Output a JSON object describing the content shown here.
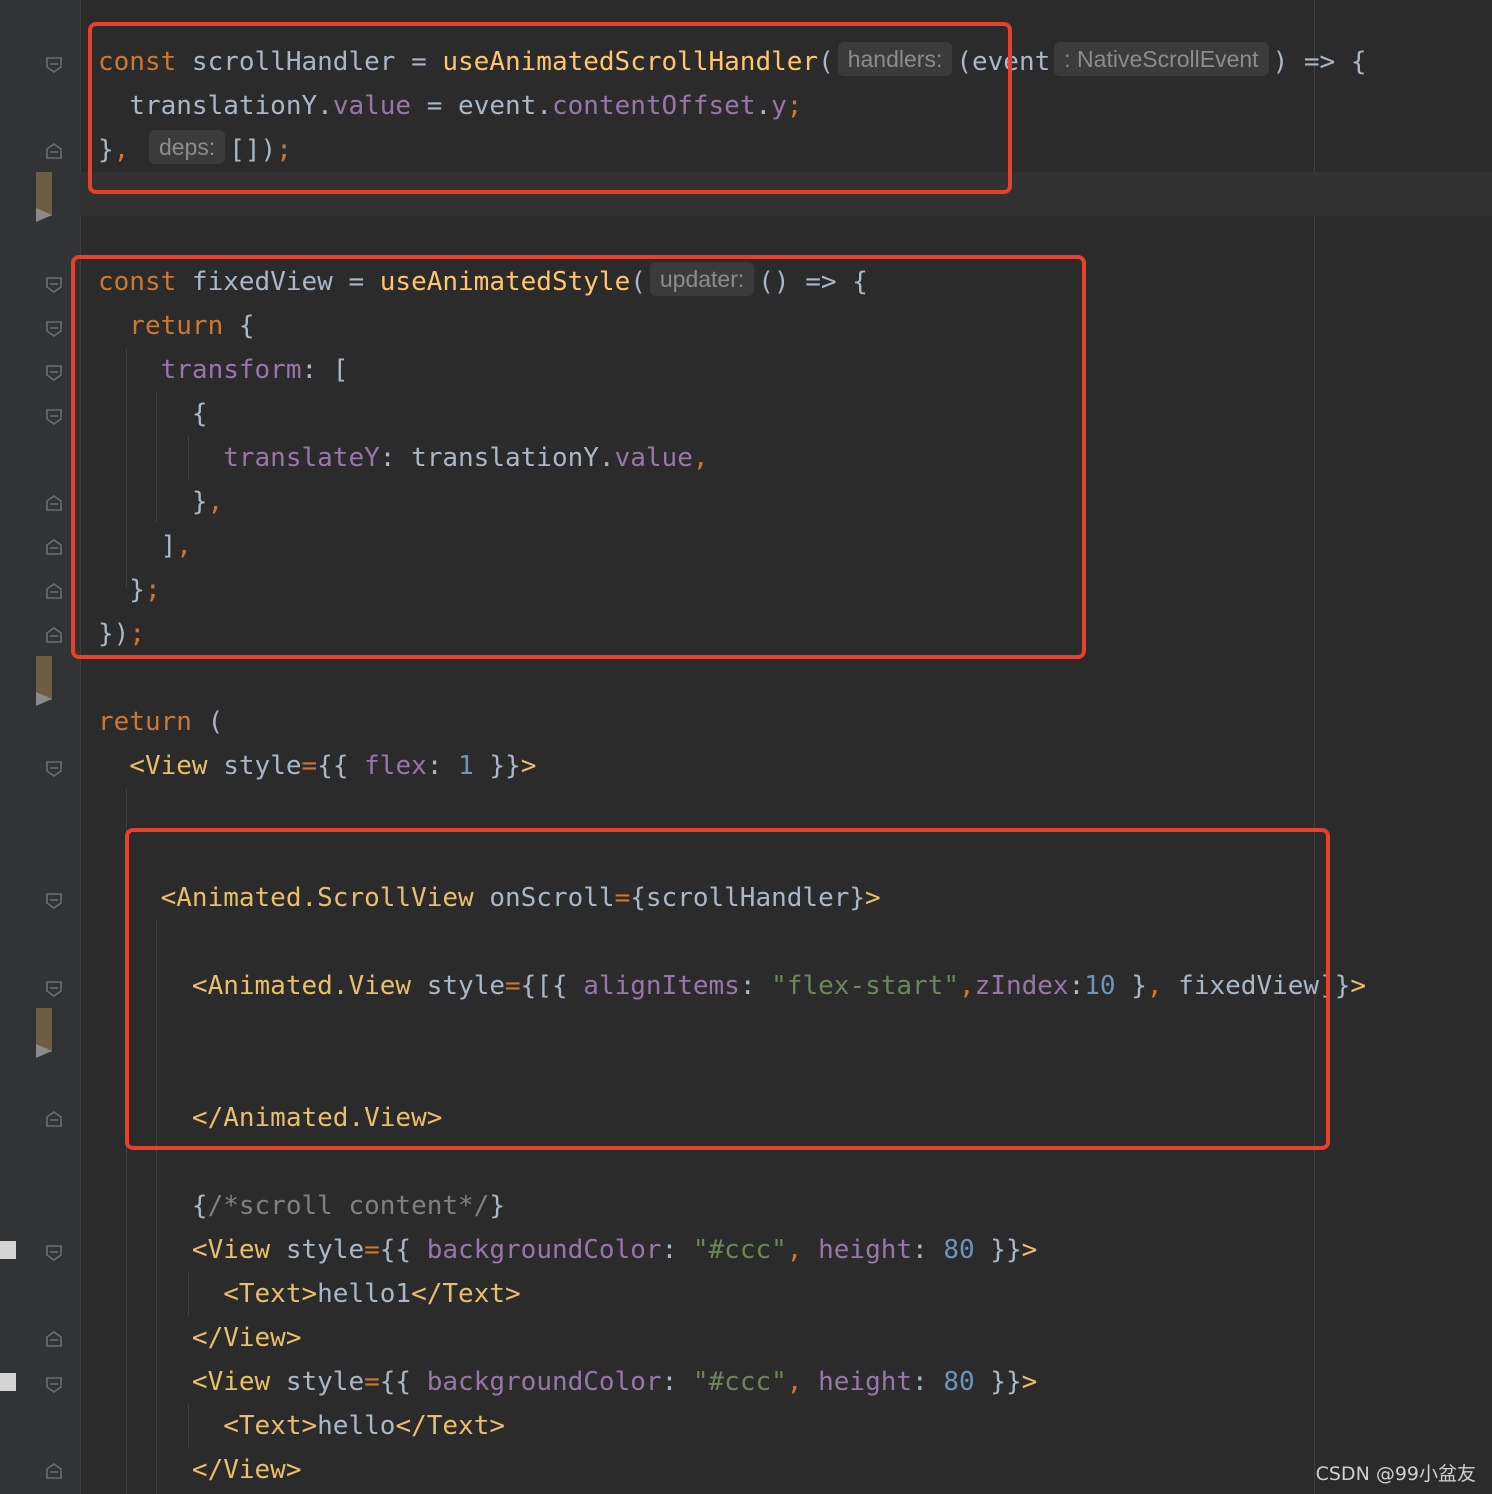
{
  "editor": {
    "lines": [
      {
        "id": "l1",
        "parts": [
          [
            "kw",
            "const "
          ],
          [
            "pl",
            "scrollHandler = "
          ],
          [
            "fn",
            "useAnimatedScrollHandler"
          ],
          [
            "pl",
            "("
          ],
          [
            "hint",
            "handlers:"
          ],
          [
            "pl",
            "(event"
          ],
          [
            "hint",
            ": NativeScrollEvent"
          ],
          [
            "pl",
            ") => {"
          ]
        ]
      },
      {
        "id": "l2",
        "parts": [
          [
            "pl",
            "  translationY."
          ],
          [
            "prop",
            "value"
          ],
          [
            "pl",
            " = event."
          ],
          [
            "prop",
            "contentOffset"
          ],
          [
            "pl",
            "."
          ],
          [
            "prop",
            "y"
          ],
          [
            "kw",
            ";"
          ]
        ]
      },
      {
        "id": "l3",
        "parts": [
          [
            "pl",
            "}"
          ],
          [
            "kw",
            ", "
          ],
          [
            "hint",
            "deps:"
          ],
          [
            "pl",
            "[])"
          ],
          [
            "kw",
            ";"
          ]
        ]
      },
      {
        "id": "l5",
        "parts": [
          [
            "kw",
            "const "
          ],
          [
            "pl",
            "fixedView = "
          ],
          [
            "fn",
            "useAnimatedStyle"
          ],
          [
            "pl",
            "("
          ],
          [
            "hint",
            "updater:"
          ],
          [
            "pl",
            "() => {"
          ]
        ]
      },
      {
        "id": "l6",
        "parts": [
          [
            "kw",
            "  return "
          ],
          [
            "pl",
            "{"
          ]
        ]
      },
      {
        "id": "l7",
        "parts": [
          [
            "prop",
            "    transform"
          ],
          [
            "pl",
            ": ["
          ]
        ]
      },
      {
        "id": "l8",
        "parts": [
          [
            "pl",
            "      {"
          ]
        ]
      },
      {
        "id": "l9",
        "parts": [
          [
            "prop",
            "        translateY"
          ],
          [
            "pl",
            ": translationY."
          ],
          [
            "prop",
            "value"
          ],
          [
            "kw",
            ","
          ]
        ]
      },
      {
        "id": "l10",
        "parts": [
          [
            "pl",
            "      }"
          ],
          [
            "kw",
            ","
          ]
        ]
      },
      {
        "id": "l11",
        "parts": [
          [
            "pl",
            "    ]"
          ],
          [
            "kw",
            ","
          ]
        ]
      },
      {
        "id": "l12",
        "parts": [
          [
            "pl",
            "  }"
          ],
          [
            "kw",
            ";"
          ]
        ]
      },
      {
        "id": "l13",
        "parts": [
          [
            "pl",
            "})"
          ],
          [
            "kw",
            ";"
          ]
        ]
      },
      {
        "id": "l15",
        "parts": [
          [
            "kw",
            "return "
          ],
          [
            "pl",
            "("
          ]
        ]
      },
      {
        "id": "l16",
        "parts": [
          [
            "tag",
            "  <View "
          ],
          [
            "pl",
            "style"
          ],
          [
            "kw",
            "="
          ],
          [
            "pl",
            "{{ "
          ],
          [
            "prop",
            "flex"
          ],
          [
            "pl",
            ": "
          ],
          [
            "num",
            "1"
          ],
          [
            "pl",
            " }}"
          ],
          [
            "tag",
            ">"
          ]
        ]
      },
      {
        "id": "l19",
        "parts": [
          [
            "tag",
            "    <Animated.ScrollView "
          ],
          [
            "pl",
            "onScroll"
          ],
          [
            "kw",
            "="
          ],
          [
            "pl",
            "{scrollHandler}"
          ],
          [
            "tag",
            ">"
          ]
        ]
      },
      {
        "id": "l21",
        "parts": [
          [
            "tag",
            "      <Animated.View "
          ],
          [
            "pl",
            "style"
          ],
          [
            "kw",
            "="
          ],
          [
            "pl",
            "{[{ "
          ],
          [
            "prop",
            "alignItems"
          ],
          [
            "pl",
            ": "
          ],
          [
            "str",
            "\"flex-start\""
          ],
          [
            "kw",
            ","
          ],
          [
            "prop",
            "zIndex"
          ],
          [
            "pl",
            ":"
          ],
          [
            "num",
            "10"
          ],
          [
            "pl",
            " }"
          ],
          [
            "kw",
            ", "
          ],
          [
            "pl",
            "fixedView]}"
          ],
          [
            "tag",
            ">"
          ]
        ]
      },
      {
        "id": "l24",
        "parts": [
          [
            "tag",
            "      </Animated.View>"
          ]
        ]
      },
      {
        "id": "l26",
        "parts": [
          [
            "pl",
            "      {"
          ],
          [
            "cmt",
            "/*scroll content*/"
          ],
          [
            "pl",
            "}"
          ]
        ]
      },
      {
        "id": "l27",
        "parts": [
          [
            "tag",
            "      <View "
          ],
          [
            "pl",
            "style"
          ],
          [
            "kw",
            "="
          ],
          [
            "pl",
            "{{ "
          ],
          [
            "prop",
            "backgroundColor"
          ],
          [
            "pl",
            ": "
          ],
          [
            "str",
            "\"#ccc\""
          ],
          [
            "kw",
            ", "
          ],
          [
            "prop",
            "height"
          ],
          [
            "pl",
            ": "
          ],
          [
            "num",
            "80"
          ],
          [
            "pl",
            " }}"
          ],
          [
            "tag",
            ">"
          ]
        ]
      },
      {
        "id": "l28",
        "parts": [
          [
            "tag",
            "        <Text>"
          ],
          [
            "pl",
            "hello1"
          ],
          [
            "tag",
            "</Text>"
          ]
        ]
      },
      {
        "id": "l29",
        "parts": [
          [
            "tag",
            "      </View>"
          ]
        ]
      },
      {
        "id": "l30",
        "parts": [
          [
            "tag",
            "      <View "
          ],
          [
            "pl",
            "style"
          ],
          [
            "kw",
            "="
          ],
          [
            "pl",
            "{{ "
          ],
          [
            "prop",
            "backgroundColor"
          ],
          [
            "pl",
            ": "
          ],
          [
            "str",
            "\"#ccc\""
          ],
          [
            "kw",
            ", "
          ],
          [
            "prop",
            "height"
          ],
          [
            "pl",
            ": "
          ],
          [
            "num",
            "80"
          ],
          [
            "pl",
            " }}"
          ],
          [
            "tag",
            ">"
          ]
        ]
      },
      {
        "id": "l31",
        "parts": [
          [
            "tag",
            "        <Text>"
          ],
          [
            "pl",
            "hello"
          ],
          [
            "tag",
            "</Text>"
          ]
        ]
      },
      {
        "id": "l32",
        "parts": [
          [
            "tag",
            "      </View>"
          ]
        ]
      }
    ]
  },
  "watermark": "CSDN @99小盆友",
  "colors": {
    "background": "#2b2b2b",
    "keyword": "#cc7832",
    "function": "#ffc66d",
    "property": "#9876aa",
    "string": "#6a8759",
    "number": "#6897bb",
    "tag": "#e8bf6a",
    "highlight_box": "#e8402a"
  }
}
